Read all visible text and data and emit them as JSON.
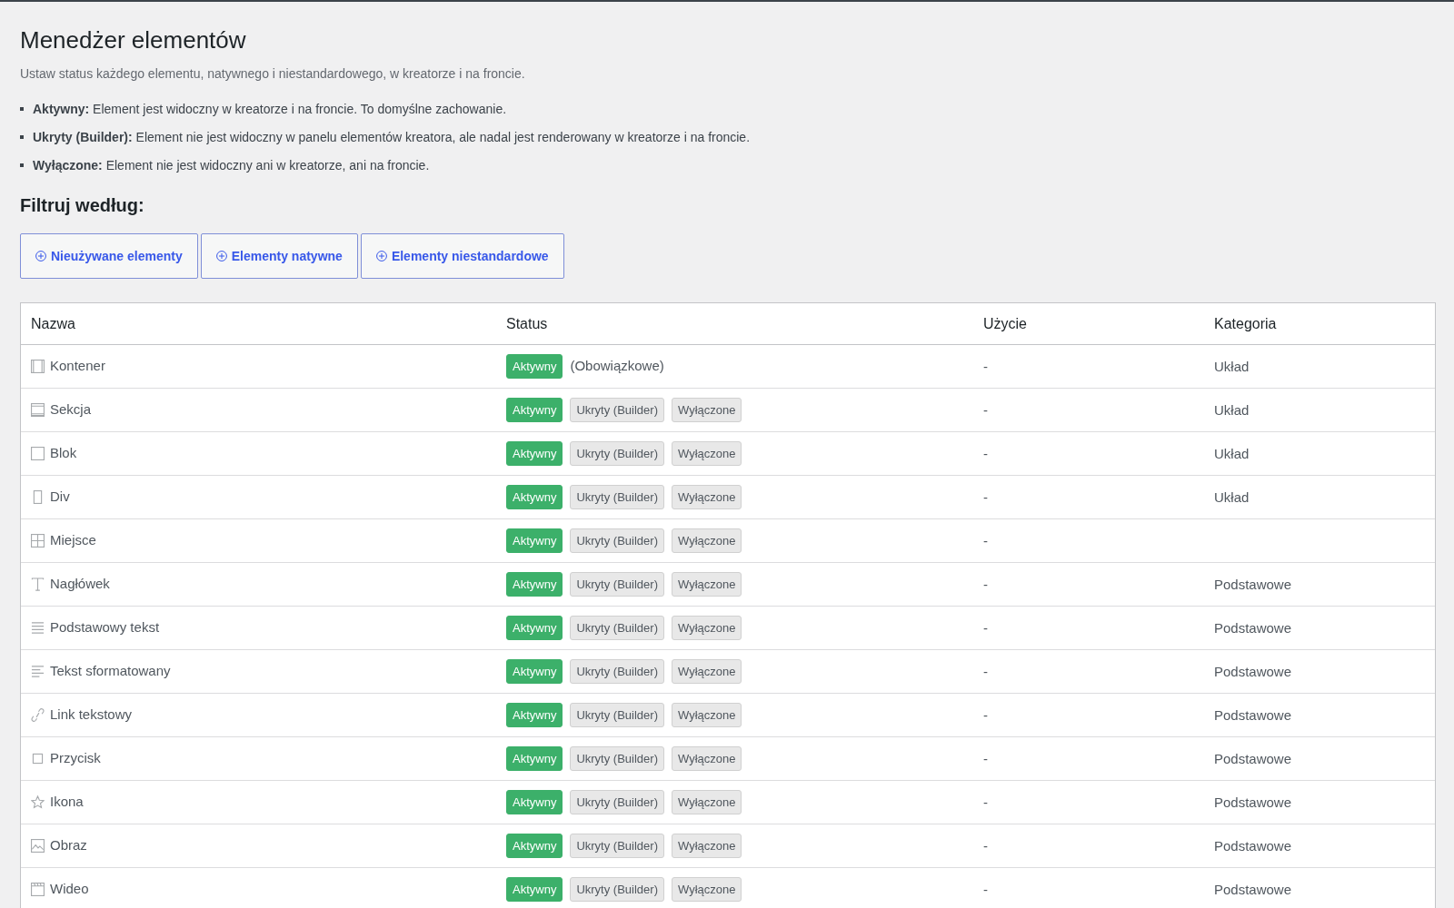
{
  "header": {
    "title": "Menedżer elementów",
    "subtitle": "Ustaw status każdego elementu, natywnego i niestandardowego, w kreatorze i na froncie.",
    "legend": [
      "**Aktywny:** Element jest widoczny w kreatorze i na froncie. To domyślne zachowanie.",
      "**Ukryty (Builder):** Element nie jest widoczny w panelu elementów kreatora, ale nadal jest renderowany w kreatorze i na froncie.",
      "**Wyłączone:** Element nie jest widoczny ani w kreatorze, ani na froncie."
    ]
  },
  "filter": {
    "label": "Filtruj według:",
    "buttons": [
      "Nieużywane elementy",
      "Elementy natywne",
      "Elementy niestandardowe"
    ]
  },
  "table": {
    "columns": [
      "Nazwa",
      "Status",
      "Użycie",
      "Kategoria"
    ],
    "rows": [
      {
        "name": "Kontener",
        "status": [
          {
            "label": "Aktywny",
            "selected": true
          }
        ],
        "note": "(Obowiązkowe)",
        "usage": "-",
        "category": "Układ"
      },
      {
        "name": "Sekcja",
        "status": [
          {
            "label": "Aktywny",
            "selected": true
          },
          {
            "label": "Ukryty (Builder)",
            "selected": false
          },
          {
            "label": "Wyłączone",
            "selected": false
          }
        ],
        "usage": "-",
        "category": "Układ"
      },
      {
        "name": "Blok",
        "status": [
          {
            "label": "Aktywny",
            "selected": true
          },
          {
            "label": "Ukryty (Builder)",
            "selected": false
          },
          {
            "label": "Wyłączone",
            "selected": false
          }
        ],
        "usage": "-",
        "category": "Układ"
      },
      {
        "name": "Div",
        "status": [
          {
            "label": "Aktywny",
            "selected": true
          },
          {
            "label": "Ukryty (Builder)",
            "selected": false
          },
          {
            "label": "Wyłączone",
            "selected": false
          }
        ],
        "usage": "-",
        "category": "Układ"
      },
      {
        "name": "Miejsce",
        "status": [
          {
            "label": "Aktywny",
            "selected": true
          },
          {
            "label": "Ukryty (Builder)",
            "selected": false
          },
          {
            "label": "Wyłączone",
            "selected": false
          }
        ],
        "usage": "-"
      },
      {
        "name": "Nagłówek",
        "status": [
          {
            "label": "Aktywny",
            "selected": true
          },
          {
            "label": "Ukryty (Builder)",
            "selected": false
          },
          {
            "label": "Wyłączone",
            "selected": false
          }
        ],
        "usage": "-",
        "category": "Podstawowe"
      },
      {
        "name": "Podstawowy tekst",
        "status": [
          {
            "label": "Aktywny",
            "selected": true
          },
          {
            "label": "Ukryty (Builder)",
            "selected": false
          },
          {
            "label": "Wyłączone",
            "selected": false
          }
        ],
        "usage": "-",
        "category": "Podstawowe"
      },
      {
        "name": "Tekst sformatowany",
        "status": [
          {
            "label": "Aktywny",
            "selected": true
          },
          {
            "label": "Ukryty (Builder)",
            "selected": false
          },
          {
            "label": "Wyłączone",
            "selected": false
          }
        ],
        "usage": "-",
        "category": "Podstawowe"
      },
      {
        "name": "Link tekstowy",
        "status": [
          {
            "label": "Aktywny",
            "selected": true
          },
          {
            "label": "Ukryty (Builder)",
            "selected": false
          },
          {
            "label": "Wyłączone",
            "selected": false
          }
        ],
        "usage": "-",
        "category": "Podstawowe"
      },
      {
        "name": "Przycisk",
        "status": [
          {
            "label": "Aktywny",
            "selected": true
          },
          {
            "label": "Ukryty (Builder)",
            "selected": false
          },
          {
            "label": "Wyłączone",
            "selected": false
          }
        ],
        "usage": "-",
        "category": "Podstawowe"
      },
      {
        "name": "Ikona",
        "status": [
          {
            "label": "Aktywny",
            "selected": true
          },
          {
            "label": "Ukryty (Builder)",
            "selected": false
          },
          {
            "label": "Wyłączone",
            "selected": false
          }
        ],
        "usage": "-",
        "category": "Podstawowe"
      },
      {
        "name": "Obraz",
        "status": [
          {
            "label": "Aktywny",
            "selected": true
          },
          {
            "label": "Ukryty (Builder)",
            "selected": false
          },
          {
            "label": "Wyłączone",
            "selected": false
          }
        ],
        "usage": "-",
        "category": "Podstawowe"
      },
      {
        "name": "Wideo",
        "status": [
          {
            "label": "Aktywny",
            "selected": true
          },
          {
            "label": "Ukryty (Builder)",
            "selected": false
          },
          {
            "label": "Wyłączone",
            "selected": false
          }
        ],
        "usage": "-",
        "category": "Podstawowe"
      }
    ]
  }
}
